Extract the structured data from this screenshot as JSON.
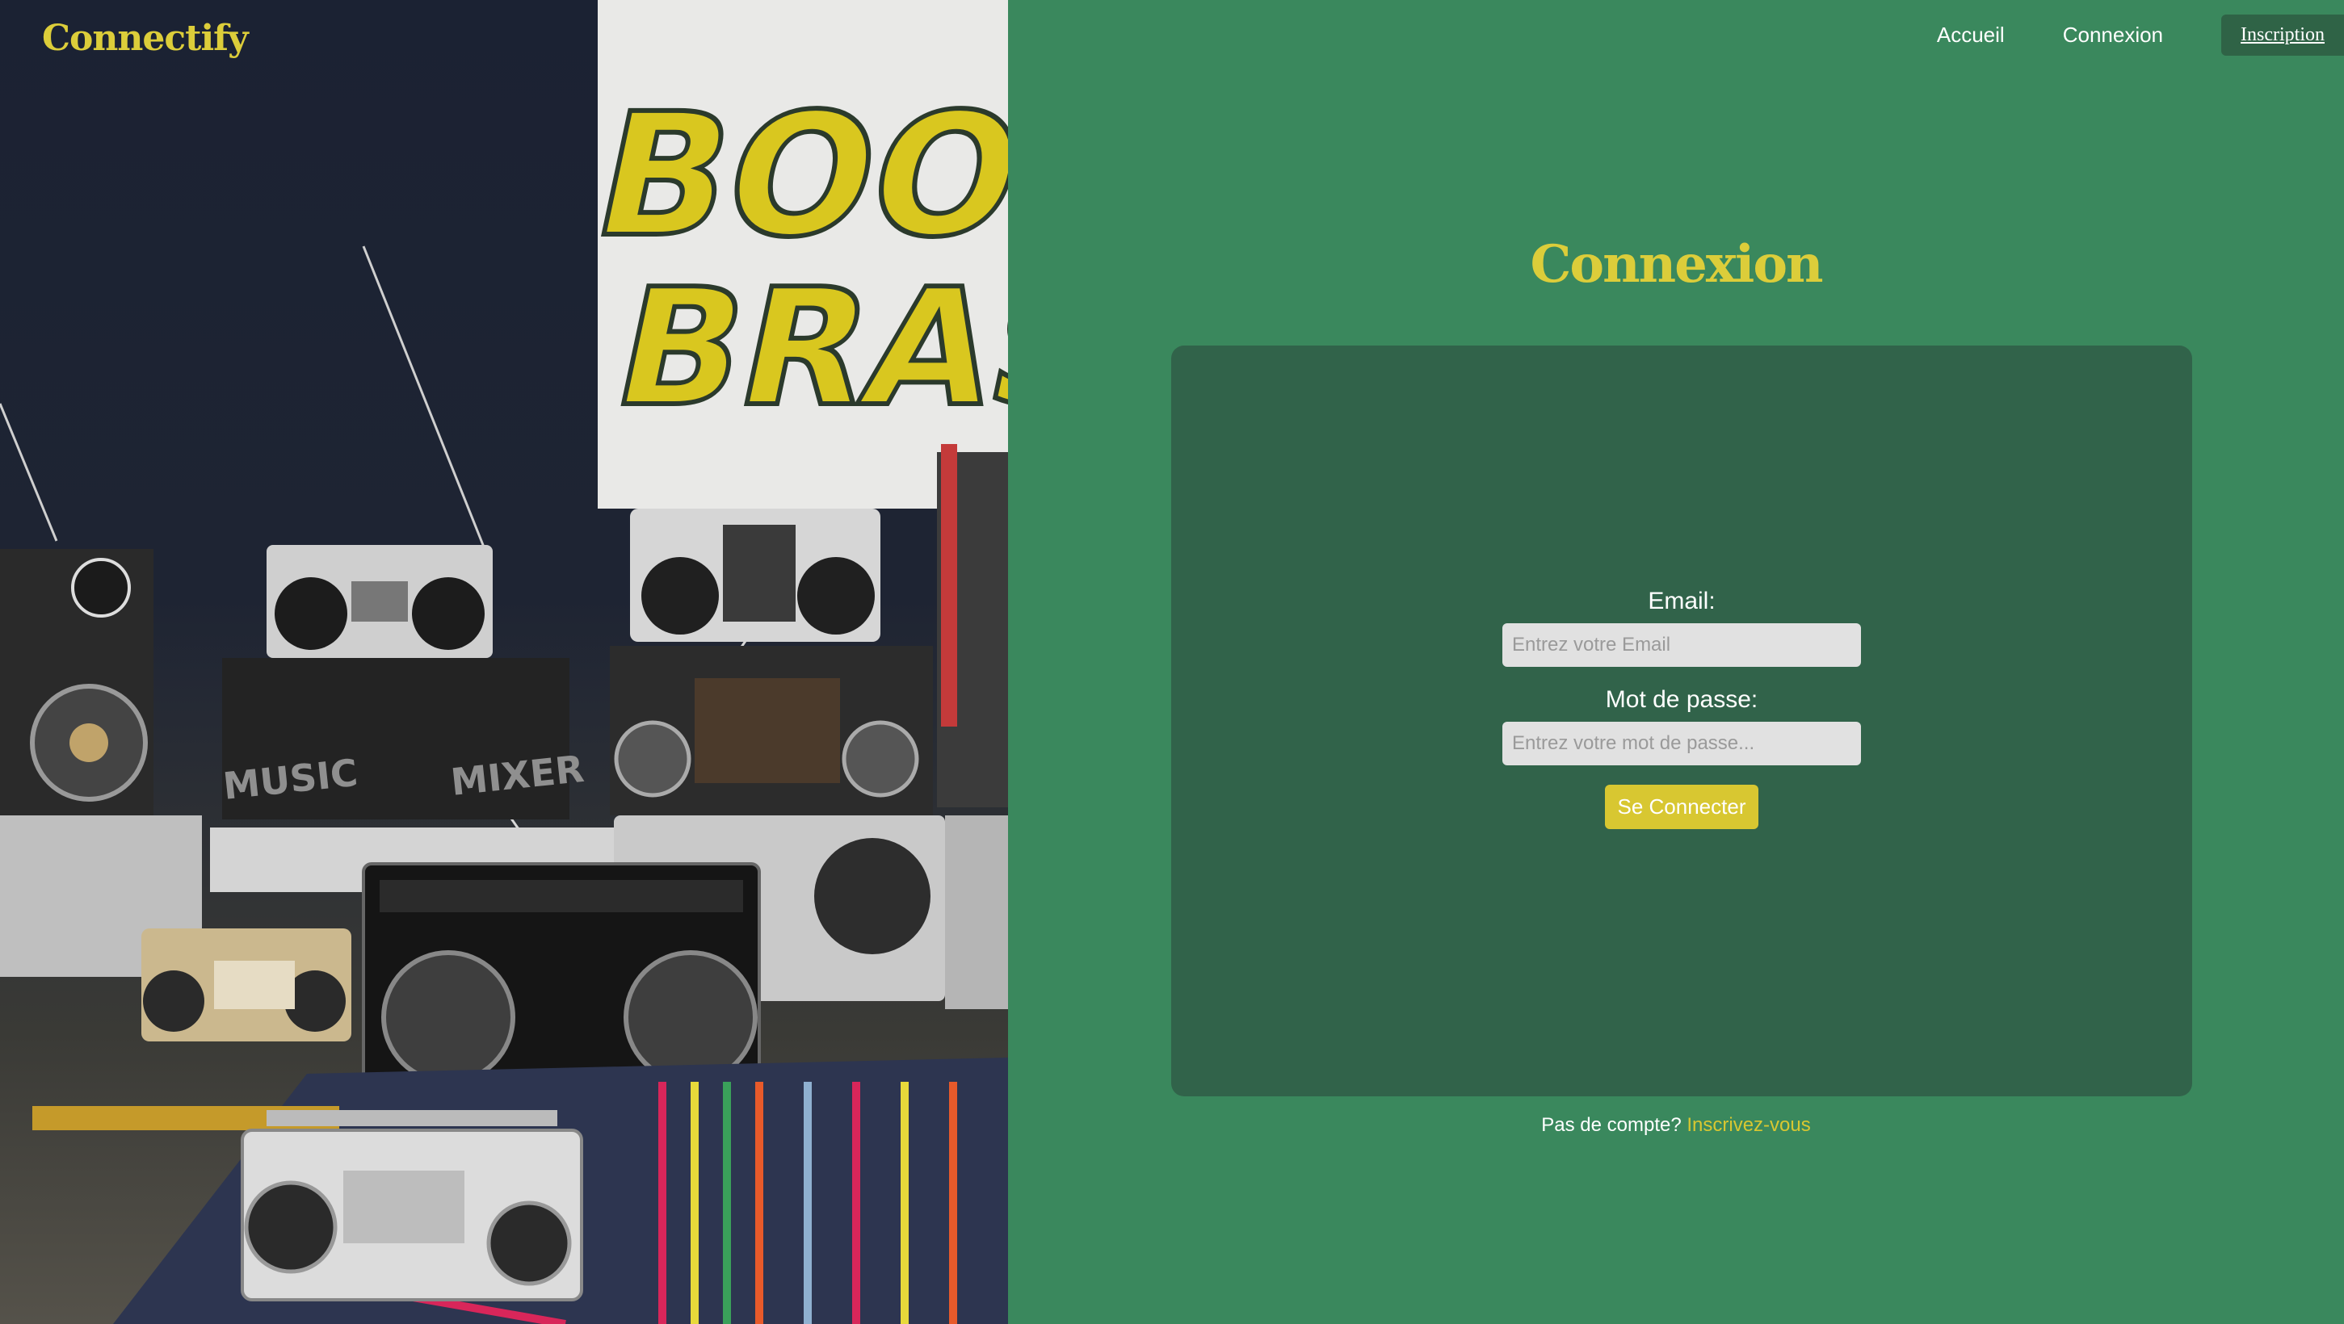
{
  "brand": {
    "name": "Connectify"
  },
  "nav": {
    "items": [
      {
        "label": "Accueil"
      },
      {
        "label": "Connexion"
      },
      {
        "label": "Inscription"
      }
    ]
  },
  "hero_image": {
    "description_text": [
      "BOOMB",
      "BRAS",
      "MUSIC",
      "MIXER"
    ]
  },
  "login": {
    "title": "Connexion",
    "email_label": "Email:",
    "email_placeholder": "Entrez votre Email",
    "email_value": "",
    "password_label": "Mot de passe:",
    "password_placeholder": "Entrez votre mot de passe...",
    "password_value": "",
    "submit_label": "Se Connecter"
  },
  "footer": {
    "prompt": "Pas de compte?",
    "link_label": "Inscrivez-vous"
  },
  "colors": {
    "background_green": "#3a885d",
    "card_green": "#31634a",
    "accent_yellow": "#dccd3a",
    "nav_active_bg": "#2f6346",
    "input_bg": "#e1e1e1"
  }
}
